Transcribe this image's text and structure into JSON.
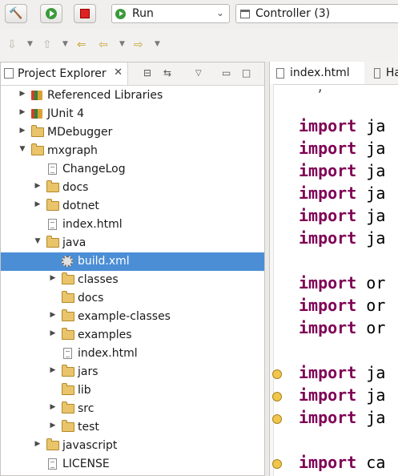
{
  "toolbar": {
    "run_config": "Run",
    "target": "Controller (3)"
  },
  "explorer": {
    "tab_label": "Project Explorer",
    "tab_close": "✕",
    "tree": [
      {
        "label": "Referenced Libraries",
        "icon": "library-icon",
        "twisty": "collapsed",
        "depth": 1
      },
      {
        "label": "JUnit 4",
        "icon": "library-icon",
        "twisty": "collapsed",
        "depth": 1
      },
      {
        "label": "MDebugger",
        "icon": "folder-icon",
        "twisty": "collapsed",
        "depth": 1
      },
      {
        "label": "mxgraph",
        "icon": "folder-icon",
        "twisty": "expanded",
        "depth": 1
      },
      {
        "label": "ChangeLog",
        "icon": "file-icon",
        "twisty": "none",
        "depth": 2
      },
      {
        "label": "docs",
        "icon": "folder-icon",
        "twisty": "collapsed",
        "depth": 2
      },
      {
        "label": "dotnet",
        "icon": "folder-icon",
        "twisty": "collapsed",
        "depth": 2
      },
      {
        "label": "index.html",
        "icon": "file-icon",
        "twisty": "none",
        "depth": 2
      },
      {
        "label": "java",
        "icon": "folder-icon",
        "twisty": "expanded",
        "depth": 2
      },
      {
        "label": "build.xml",
        "icon": "ant-build-icon",
        "twisty": "none",
        "depth": 3,
        "selected": true
      },
      {
        "label": "classes",
        "icon": "folder-icon",
        "twisty": "collapsed",
        "depth": 3
      },
      {
        "label": "docs",
        "icon": "folder-icon",
        "twisty": "none",
        "depth": 3
      },
      {
        "label": "example-classes",
        "icon": "folder-icon",
        "twisty": "collapsed",
        "depth": 3
      },
      {
        "label": "examples",
        "icon": "folder-icon",
        "twisty": "collapsed",
        "depth": 3
      },
      {
        "label": "index.html",
        "icon": "file-icon",
        "twisty": "none",
        "depth": 3
      },
      {
        "label": "jars",
        "icon": "folder-icon",
        "twisty": "collapsed",
        "depth": 3
      },
      {
        "label": "lib",
        "icon": "folder-icon",
        "twisty": "none",
        "depth": 3
      },
      {
        "label": "src",
        "icon": "folder-icon",
        "twisty": "collapsed",
        "depth": 3
      },
      {
        "label": "test",
        "icon": "folder-icon",
        "twisty": "collapsed",
        "depth": 3
      },
      {
        "label": "javascript",
        "icon": "folder-icon",
        "twisty": "collapsed",
        "depth": 2
      },
      {
        "label": "LICENSE",
        "icon": "file-icon",
        "twisty": "none",
        "depth": 2
      }
    ]
  },
  "editor": {
    "tabs": [
      "index.html",
      "Ha"
    ],
    "lines": [
      {
        "kw": "import",
        "rest": " ja",
        "warn": false
      },
      {
        "kw": "import",
        "rest": " ja",
        "warn": false
      },
      {
        "kw": "import",
        "rest": " ja",
        "warn": false
      },
      {
        "kw": "import",
        "rest": " ja",
        "warn": false
      },
      {
        "kw": "import",
        "rest": " ja",
        "warn": false
      },
      {
        "kw": "import",
        "rest": " ja",
        "warn": false
      },
      {
        "kw": "",
        "rest": "",
        "warn": false
      },
      {
        "kw": "import",
        "rest": " or",
        "warn": false
      },
      {
        "kw": "import",
        "rest": " or",
        "warn": false
      },
      {
        "kw": "import",
        "rest": " or",
        "warn": false
      },
      {
        "kw": "",
        "rest": "",
        "warn": false
      },
      {
        "kw": "import",
        "rest": " ja",
        "warn": true
      },
      {
        "kw": "import",
        "rest": " ja",
        "warn": true
      },
      {
        "kw": "import",
        "rest": " ja",
        "warn": true
      },
      {
        "kw": "",
        "rest": "",
        "warn": false
      },
      {
        "kw": "import",
        "rest": " ca",
        "warn": true
      }
    ]
  }
}
